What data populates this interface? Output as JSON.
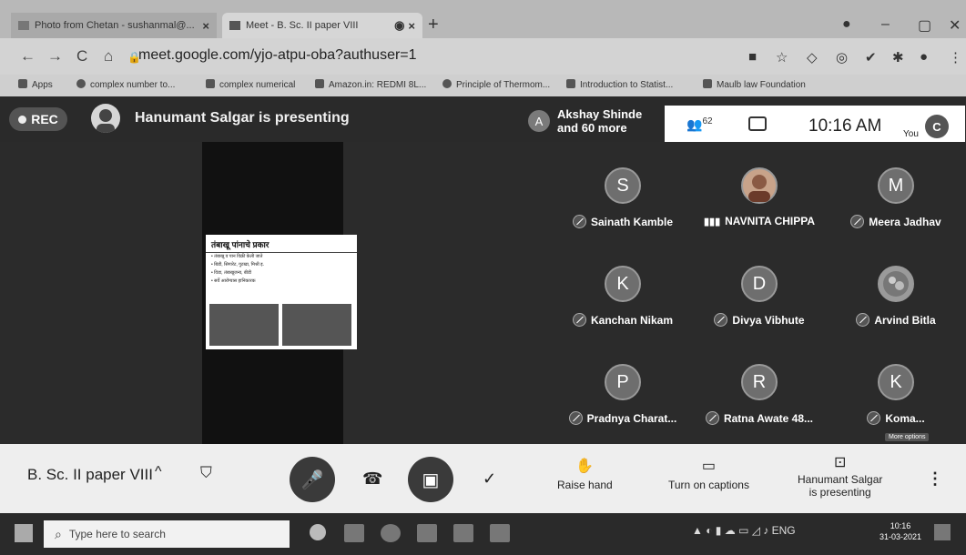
{
  "browser": {
    "tabs": [
      {
        "label": "Photo from Chetan - sushanmal@..."
      },
      {
        "label": "Meet - B. Sc. II paper VIII"
      }
    ],
    "new_tab_symbol": "+",
    "nav": {
      "back": "←",
      "forward": "→",
      "reload": "C",
      "home": "⌂"
    },
    "url": "meet.google.com/yjo-atpu-oba?authuser=1",
    "bookmarks": [
      "Apps",
      "complex number to...",
      "complex numerical",
      "Amazon.in: REDMI 8L...",
      "Principle of Thermom...",
      "Introduction to Statist...",
      "Maulb law Foundation"
    ]
  },
  "meet": {
    "rec_label": "REC",
    "presenting_title": "Hanumant Salgar is presenting",
    "others": {
      "initial": "A",
      "line1": "Akshay Shinde",
      "line2": "and 60 more"
    },
    "people_count": "62",
    "time": "10:16 AM",
    "you_label": "You",
    "you_initial": "C",
    "slide": {
      "title": "तंबाखू पांनाचे प्रकार",
      "lines": [
        "• तंबाखू व पान विक्री केली जाते",
        "• बिडी, सिगारेट, गुटखा, मिश्री इ.",
        "• विडा, तंबाखूजन्य, बीडी",
        "• सर्वे आरोग्यास हानिकारक"
      ]
    },
    "participants": [
      {
        "initial": "S",
        "name": "Sainath Kamble",
        "muted": true
      },
      {
        "initial": "",
        "name": "NAVNITA CHIPPA",
        "muted": false
      },
      {
        "initial": "M",
        "name": "Meera Jadhav",
        "muted": true
      },
      {
        "initial": "K",
        "name": "Kanchan Nikam",
        "muted": true
      },
      {
        "initial": "D",
        "name": "Divya Vibhute",
        "muted": true
      },
      {
        "initial": "",
        "name": "Arvind Bitla",
        "muted": true
      },
      {
        "initial": "P",
        "name": "Pradnya Charat...",
        "muted": true
      },
      {
        "initial": "R",
        "name": "Ratna Awate 48...",
        "muted": true
      },
      {
        "initial": "K",
        "name": "Koma...",
        "muted": true
      }
    ],
    "more_options_label": "More options"
  },
  "controls": {
    "meeting_title": "B. Sc. II paper VIII",
    "chevron": "^",
    "raise_hand": "Raise hand",
    "captions": "Turn on captions",
    "presenting_line1": "Hanumant Salgar",
    "presenting_line2": "is presenting"
  },
  "taskbar": {
    "search_placeholder": "Type here to search",
    "lang": "ENG",
    "time": "10:16",
    "date": "31-03-2021"
  }
}
